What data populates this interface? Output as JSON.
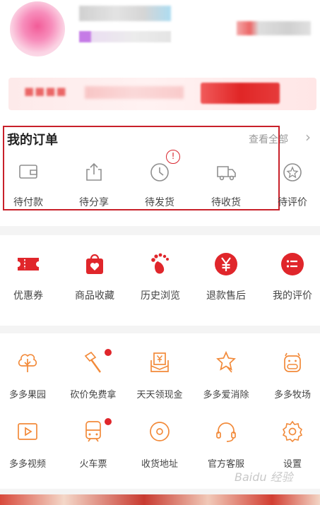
{
  "orders": {
    "title": "我的订单",
    "view_all": "查看全部",
    "notice_badge": "!",
    "items": [
      {
        "label": "待付款",
        "icon": "wallet-icon"
      },
      {
        "label": "待分享",
        "icon": "share-icon"
      },
      {
        "label": "待发货",
        "icon": "clock-icon"
      },
      {
        "label": "待收货",
        "icon": "truck-icon"
      },
      {
        "label": "待评价",
        "icon": "star-icon"
      }
    ]
  },
  "services": {
    "items": [
      {
        "label": "优惠券",
        "icon": "coupon-icon"
      },
      {
        "label": "商品收藏",
        "icon": "favorite-bag-icon"
      },
      {
        "label": "历史浏览",
        "icon": "footprint-icon"
      },
      {
        "label": "退款售后",
        "icon": "refund-yen-icon"
      },
      {
        "label": "我的评价",
        "icon": "review-list-icon"
      }
    ]
  },
  "tools": {
    "items": [
      {
        "label": "多多果园",
        "icon": "tree-icon"
      },
      {
        "label": "砍价免费拿",
        "icon": "axe-icon"
      },
      {
        "label": "天天领现金",
        "icon": "cash-envelope-icon"
      },
      {
        "label": "多多爱消除",
        "icon": "star-match-icon"
      },
      {
        "label": "多多牧场",
        "icon": "cow-icon"
      },
      {
        "label": "多多视频",
        "icon": "video-icon"
      },
      {
        "label": "火车票",
        "icon": "train-icon"
      },
      {
        "label": "收货地址",
        "icon": "location-icon"
      },
      {
        "label": "官方客服",
        "icon": "headset-icon"
      },
      {
        "label": "设置",
        "icon": "settings-icon"
      }
    ]
  },
  "watermark": "Baidu 经验",
  "colors": {
    "accent_red": "#e0262b",
    "orange_icon": "#f28a3a",
    "gray_icon": "#8f8f8f",
    "highlight_frame": "#c8202a"
  }
}
